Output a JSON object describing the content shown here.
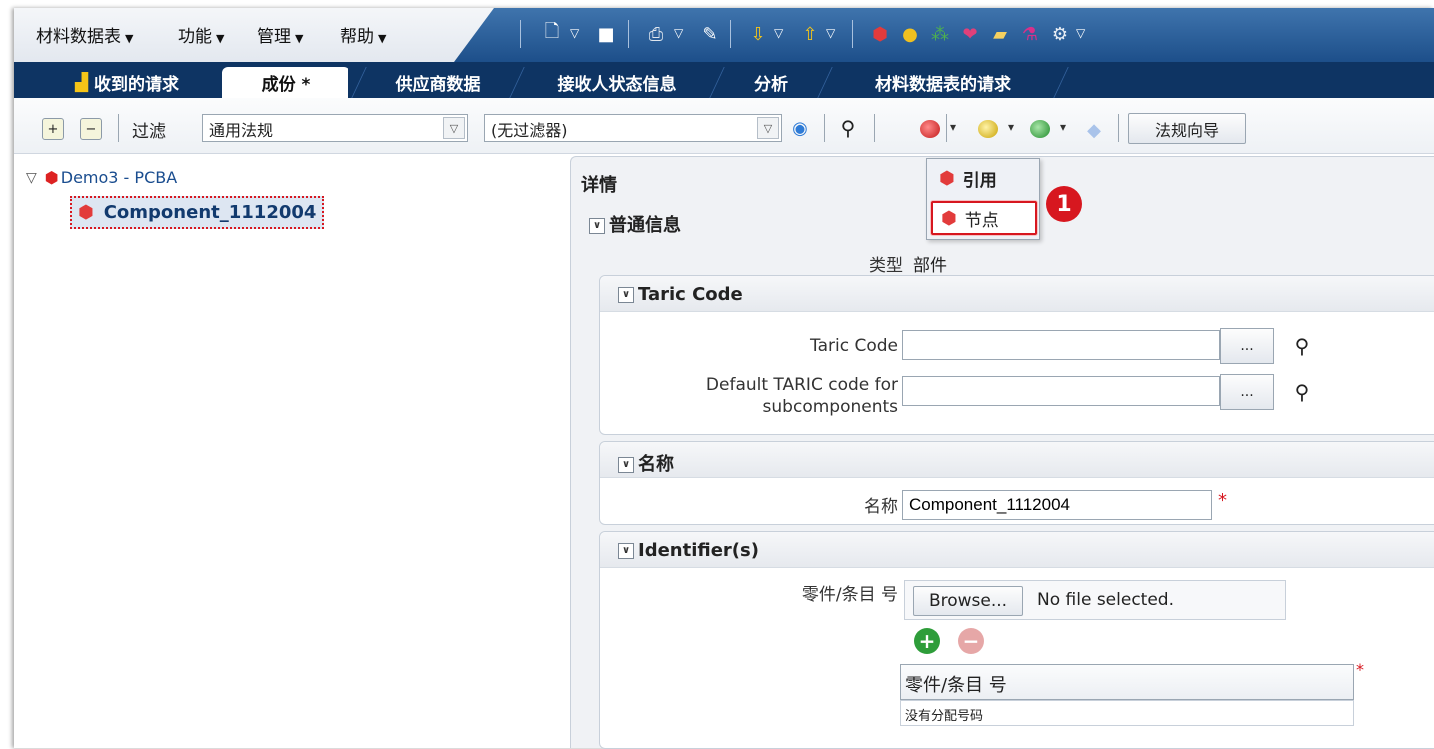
{
  "menu": {
    "items": [
      {
        "label": "材料数据表"
      },
      {
        "label": "功能"
      },
      {
        "label": "管理"
      },
      {
        "label": "帮助"
      }
    ]
  },
  "tabs": [
    {
      "label": "收到的请求",
      "icon": "inbox-icon"
    },
    {
      "label": "成份 *",
      "active": true
    },
    {
      "label": "供应商数据"
    },
    {
      "label": "接收人状态信息"
    },
    {
      "label": "分析"
    },
    {
      "label": "材料数据表的请求"
    }
  ],
  "filterbar": {
    "filter_label": "过滤",
    "filter_select_value": "通用法规",
    "filter_select2_value": "(无过滤器)",
    "legislation_wizard_label": "法规向导"
  },
  "tree": {
    "root_label": "Demo3 - PCBA",
    "child_label": "Component_1112004"
  },
  "details": {
    "title": "详情",
    "general_info_title": "普通信息",
    "type_label": "类型",
    "type_value": "部件",
    "taric_section_title": "Taric Code",
    "taric_code_label": "Taric Code",
    "taric_code_value": "",
    "default_taric_label": "Default TARIC code for subcomponents",
    "default_taric_value": "",
    "dots_label": "...",
    "name_section_title": "名称",
    "name_label": "名称",
    "name_value": "Component_1112004",
    "required_marker": "*",
    "identifiers_section_title": "Identifier(s)",
    "part_number_label": "零件/条目 号",
    "browse_label": "Browse...",
    "no_file_text": "No file selected.",
    "table_header": "零件/条目 号",
    "table_empty_text": "没有分配号码"
  },
  "popup": {
    "item_reference": "引用",
    "item_node": "节点"
  },
  "annotation": {
    "step_number": "1"
  },
  "colors": {
    "accent_red": "#d7171f",
    "tabbar_navy": "#0e3463",
    "menubar_blue": "#2a5e9a"
  }
}
